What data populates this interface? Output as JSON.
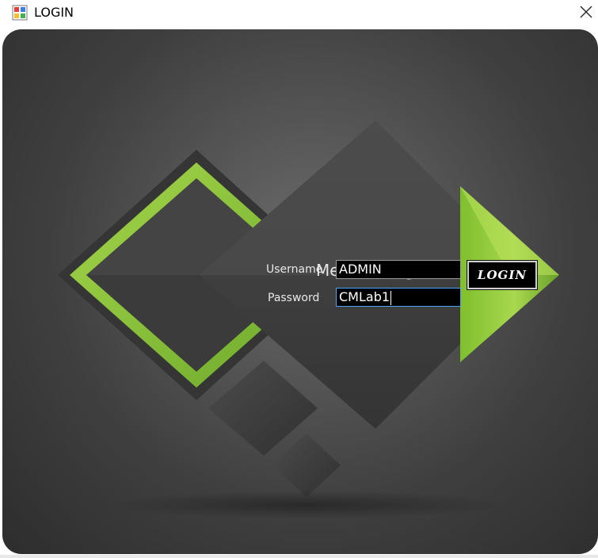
{
  "window": {
    "title": "LOGIN",
    "app_icon": "windows-form-icon",
    "close_icon": "close-icon"
  },
  "form": {
    "heading": "Member Login",
    "username_label": "Username",
    "username_value": "ADMIN",
    "password_label": "Password",
    "password_value": "CMLab1",
    "login_button": "LOGIN"
  },
  "colors": {
    "accent_green": "#8cc63f",
    "background_dark": "#3f3f3f",
    "field_background": "#000000",
    "focus_border": "#4aa3ff"
  }
}
